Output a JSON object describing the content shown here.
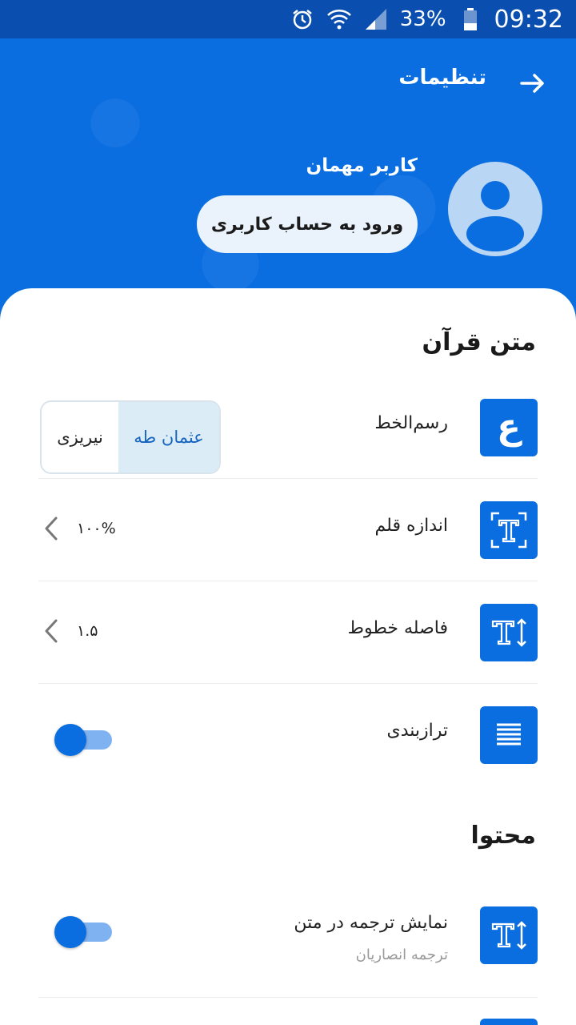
{
  "status_bar": {
    "battery": "33%",
    "time": "09:32"
  },
  "header": {
    "title": "تنظیمات",
    "user_name": "کاربر مهمان",
    "login_button": "ورود به حساب کاربری"
  },
  "sections": {
    "quran_text": {
      "title": "متن قرآن",
      "script": {
        "label": "رسم‌الخط",
        "icon_char": "ع",
        "options": [
          "عثمان طه",
          "نیریزی"
        ],
        "selected": "عثمان طه"
      },
      "font_size": {
        "label": "اندازه قلم",
        "value": "۱۰۰%"
      },
      "line_spacing": {
        "label": "فاصله خطوط",
        "value": "۱.۵"
      },
      "justify": {
        "label": "ترازبندی",
        "enabled": true
      }
    },
    "content": {
      "title": "محتوا",
      "show_translation": {
        "label": "نمایش ترجمه در متن",
        "sublabel": "ترجمه انصاریان",
        "enabled": true
      }
    }
  },
  "colors": {
    "primary": "#0a6ee0",
    "status_bar": "#0a4fb0",
    "selected_segment": "#dcecf6"
  }
}
